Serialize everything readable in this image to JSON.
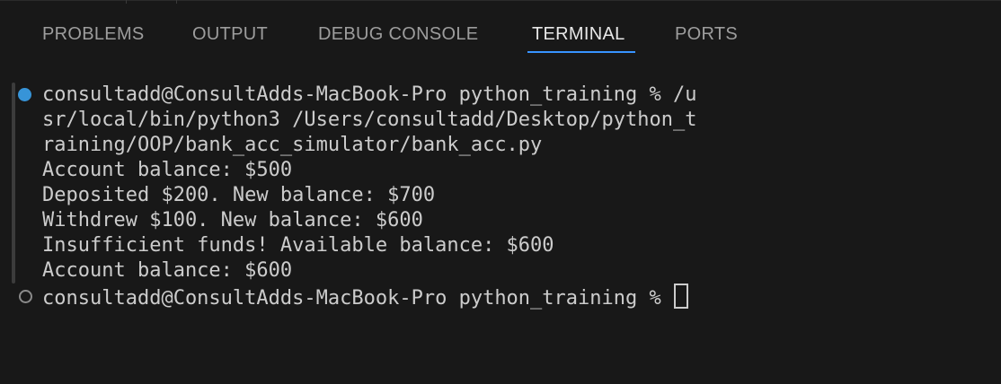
{
  "panel": {
    "tabs": [
      {
        "label": "PROBLEMS",
        "active": false
      },
      {
        "label": "OUTPUT",
        "active": false
      },
      {
        "label": "DEBUG CONSOLE",
        "active": false
      },
      {
        "label": "TERMINAL",
        "active": true
      },
      {
        "label": "PORTS",
        "active": false
      }
    ]
  },
  "terminal": {
    "lines": [
      "consultadd@ConsultAdds-MacBook-Pro python_training % /u",
      "sr/local/bin/python3 /Users/consultadd/Desktop/python_t",
      "raining/OOP/bank_acc_simulator/bank_acc.py",
      "Account balance: $500",
      "Deposited $200. New balance: $700",
      "Withdrew $100. New balance: $600",
      "Insufficient funds! Available balance: $600",
      "Account balance: $600"
    ],
    "prompt": "consultadd@ConsultAdds-MacBook-Pro python_training % "
  },
  "colors": {
    "background": "#181818",
    "active_tab_underline": "#3794ff",
    "success_decoration": "#3794d8"
  }
}
